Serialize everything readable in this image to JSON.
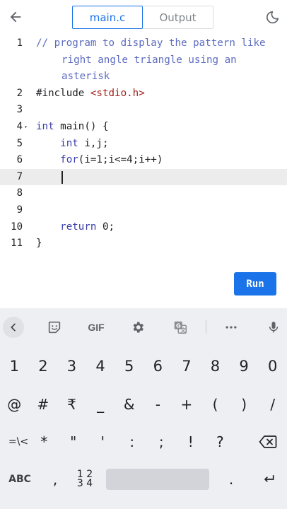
{
  "header": {
    "tabs": [
      {
        "label": "main.c",
        "active": true
      },
      {
        "label": "Output",
        "active": false
      }
    ]
  },
  "editor": {
    "lines": [
      {
        "num": "1",
        "parts": [
          {
            "t": "// program to display the pattern like",
            "c": "comment"
          }
        ],
        "cont": [
          "right angle triangle using an",
          "asterisk"
        ]
      },
      {
        "num": "2",
        "parts": [
          {
            "t": "#include ",
            "c": ""
          },
          {
            "t": "<stdio.h>",
            "c": "str"
          }
        ]
      },
      {
        "num": "3",
        "parts": []
      },
      {
        "num": "4",
        "fold": true,
        "parts": [
          {
            "t": "int",
            "c": "kw"
          },
          {
            "t": " main() {",
            "c": ""
          }
        ]
      },
      {
        "num": "5",
        "parts": [
          {
            "t": "    ",
            "c": ""
          },
          {
            "t": "int",
            "c": "kw"
          },
          {
            "t": " i,j;",
            "c": ""
          }
        ]
      },
      {
        "num": "6",
        "parts": [
          {
            "t": "    ",
            "c": ""
          },
          {
            "t": "for",
            "c": "kw"
          },
          {
            "t": "(i=1;i<=4;i++)",
            "c": ""
          }
        ]
      },
      {
        "num": "7",
        "current": true,
        "parts": []
      },
      {
        "num": "8",
        "parts": []
      },
      {
        "num": "9",
        "parts": []
      },
      {
        "num": "10",
        "parts": [
          {
            "t": "    ",
            "c": ""
          },
          {
            "t": "return",
            "c": "kw"
          },
          {
            "t": " 0;",
            "c": ""
          }
        ]
      },
      {
        "num": "11",
        "parts": [
          {
            "t": "}",
            "c": ""
          }
        ]
      }
    ],
    "run_label": "Run"
  },
  "keyboard": {
    "toolbar": {
      "gif_label": "GIF"
    },
    "number_row": [
      "1",
      "2",
      "3",
      "4",
      "5",
      "6",
      "7",
      "8",
      "9",
      "0"
    ],
    "symbol_row": [
      "@",
      "#",
      "₹",
      "_",
      "&",
      "-",
      "+",
      "(",
      ")",
      "/"
    ],
    "symbol_row2": [
      "=\\<",
      "*",
      "\"",
      "'",
      ":",
      ";",
      "!",
      "?"
    ],
    "bottom": {
      "abc": "ABC",
      "comma": ",",
      "numpad_top": "1 2",
      "numpad_bottom": "3 4",
      "period": "."
    }
  },
  "colors": {
    "accent": "#1a73e8",
    "keyboard_bg": "#eeeff2"
  }
}
